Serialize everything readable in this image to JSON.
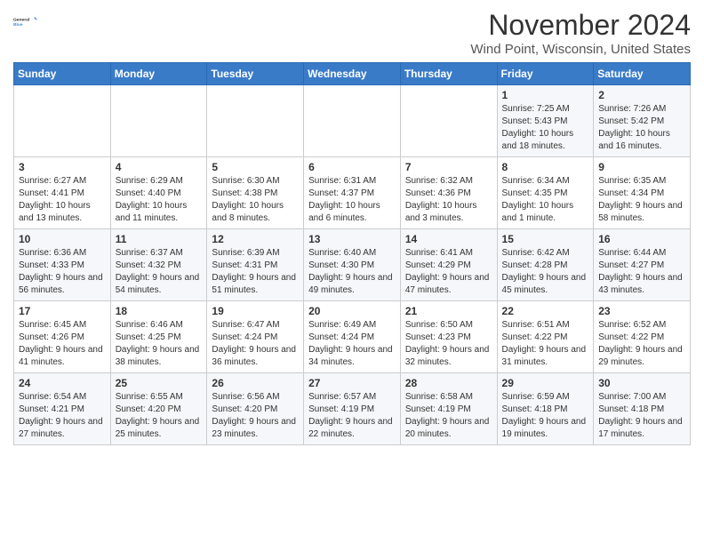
{
  "logo": {
    "line1": "General",
    "line2": "Blue"
  },
  "title": "November 2024",
  "location": "Wind Point, Wisconsin, United States",
  "weekdays": [
    "Sunday",
    "Monday",
    "Tuesday",
    "Wednesday",
    "Thursday",
    "Friday",
    "Saturday"
  ],
  "weeks": [
    [
      {
        "day": "",
        "info": ""
      },
      {
        "day": "",
        "info": ""
      },
      {
        "day": "",
        "info": ""
      },
      {
        "day": "",
        "info": ""
      },
      {
        "day": "",
        "info": ""
      },
      {
        "day": "1",
        "info": "Sunrise: 7:25 AM\nSunset: 5:43 PM\nDaylight: 10 hours and 18 minutes."
      },
      {
        "day": "2",
        "info": "Sunrise: 7:26 AM\nSunset: 5:42 PM\nDaylight: 10 hours and 16 minutes."
      }
    ],
    [
      {
        "day": "3",
        "info": "Sunrise: 6:27 AM\nSunset: 4:41 PM\nDaylight: 10 hours and 13 minutes."
      },
      {
        "day": "4",
        "info": "Sunrise: 6:29 AM\nSunset: 4:40 PM\nDaylight: 10 hours and 11 minutes."
      },
      {
        "day": "5",
        "info": "Sunrise: 6:30 AM\nSunset: 4:38 PM\nDaylight: 10 hours and 8 minutes."
      },
      {
        "day": "6",
        "info": "Sunrise: 6:31 AM\nSunset: 4:37 PM\nDaylight: 10 hours and 6 minutes."
      },
      {
        "day": "7",
        "info": "Sunrise: 6:32 AM\nSunset: 4:36 PM\nDaylight: 10 hours and 3 minutes."
      },
      {
        "day": "8",
        "info": "Sunrise: 6:34 AM\nSunset: 4:35 PM\nDaylight: 10 hours and 1 minute."
      },
      {
        "day": "9",
        "info": "Sunrise: 6:35 AM\nSunset: 4:34 PM\nDaylight: 9 hours and 58 minutes."
      }
    ],
    [
      {
        "day": "10",
        "info": "Sunrise: 6:36 AM\nSunset: 4:33 PM\nDaylight: 9 hours and 56 minutes."
      },
      {
        "day": "11",
        "info": "Sunrise: 6:37 AM\nSunset: 4:32 PM\nDaylight: 9 hours and 54 minutes."
      },
      {
        "day": "12",
        "info": "Sunrise: 6:39 AM\nSunset: 4:31 PM\nDaylight: 9 hours and 51 minutes."
      },
      {
        "day": "13",
        "info": "Sunrise: 6:40 AM\nSunset: 4:30 PM\nDaylight: 9 hours and 49 minutes."
      },
      {
        "day": "14",
        "info": "Sunrise: 6:41 AM\nSunset: 4:29 PM\nDaylight: 9 hours and 47 minutes."
      },
      {
        "day": "15",
        "info": "Sunrise: 6:42 AM\nSunset: 4:28 PM\nDaylight: 9 hours and 45 minutes."
      },
      {
        "day": "16",
        "info": "Sunrise: 6:44 AM\nSunset: 4:27 PM\nDaylight: 9 hours and 43 minutes."
      }
    ],
    [
      {
        "day": "17",
        "info": "Sunrise: 6:45 AM\nSunset: 4:26 PM\nDaylight: 9 hours and 41 minutes."
      },
      {
        "day": "18",
        "info": "Sunrise: 6:46 AM\nSunset: 4:25 PM\nDaylight: 9 hours and 38 minutes."
      },
      {
        "day": "19",
        "info": "Sunrise: 6:47 AM\nSunset: 4:24 PM\nDaylight: 9 hours and 36 minutes."
      },
      {
        "day": "20",
        "info": "Sunrise: 6:49 AM\nSunset: 4:24 PM\nDaylight: 9 hours and 34 minutes."
      },
      {
        "day": "21",
        "info": "Sunrise: 6:50 AM\nSunset: 4:23 PM\nDaylight: 9 hours and 32 minutes."
      },
      {
        "day": "22",
        "info": "Sunrise: 6:51 AM\nSunset: 4:22 PM\nDaylight: 9 hours and 31 minutes."
      },
      {
        "day": "23",
        "info": "Sunrise: 6:52 AM\nSunset: 4:22 PM\nDaylight: 9 hours and 29 minutes."
      }
    ],
    [
      {
        "day": "24",
        "info": "Sunrise: 6:54 AM\nSunset: 4:21 PM\nDaylight: 9 hours and 27 minutes."
      },
      {
        "day": "25",
        "info": "Sunrise: 6:55 AM\nSunset: 4:20 PM\nDaylight: 9 hours and 25 minutes."
      },
      {
        "day": "26",
        "info": "Sunrise: 6:56 AM\nSunset: 4:20 PM\nDaylight: 9 hours and 23 minutes."
      },
      {
        "day": "27",
        "info": "Sunrise: 6:57 AM\nSunset: 4:19 PM\nDaylight: 9 hours and 22 minutes."
      },
      {
        "day": "28",
        "info": "Sunrise: 6:58 AM\nSunset: 4:19 PM\nDaylight: 9 hours and 20 minutes."
      },
      {
        "day": "29",
        "info": "Sunrise: 6:59 AM\nSunset: 4:18 PM\nDaylight: 9 hours and 19 minutes."
      },
      {
        "day": "30",
        "info": "Sunrise: 7:00 AM\nSunset: 4:18 PM\nDaylight: 9 hours and 17 minutes."
      }
    ]
  ]
}
